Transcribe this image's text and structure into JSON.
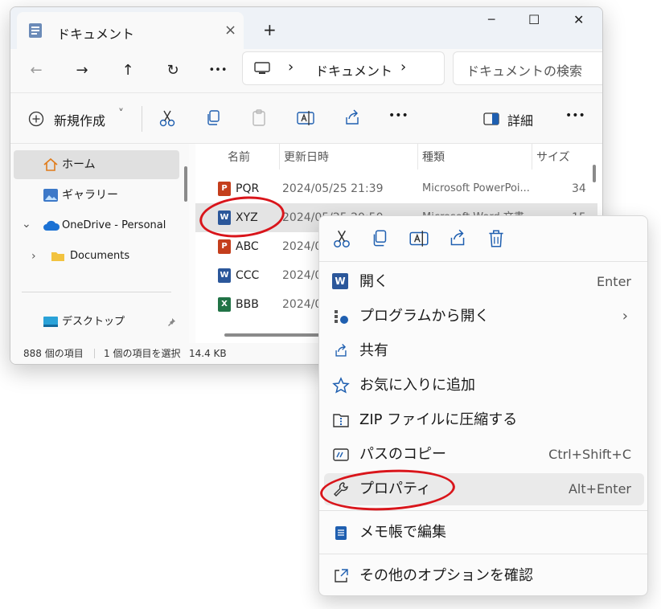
{
  "window": {
    "tab_title": "ドキュメント",
    "tab_close": "×",
    "new_tab": "+",
    "minimize": "─",
    "maximize": "☐",
    "close": "✕"
  },
  "nav": {
    "back": "←",
    "forward": "→",
    "up": "↑",
    "refresh": "↻",
    "more": "•••",
    "address_sep": "›",
    "address_location": "ドキュメント",
    "search_placeholder": "ドキュメントの検索"
  },
  "toolbar": {
    "new_label": "新規作成",
    "new_chevron": "˅",
    "more": "•••",
    "details_label": "詳細",
    "more2": "•••"
  },
  "sidebar": {
    "items": [
      {
        "label": "ホーム",
        "icon": "home-icon"
      },
      {
        "label": "ギャラリー",
        "icon": "gallery-icon"
      },
      {
        "label": "OneDrive - Personal",
        "icon": "cloud-icon",
        "expander": "⌄"
      },
      {
        "label": "Documents",
        "icon": "folder-icon",
        "expander": "›"
      },
      {
        "label": "デスクトップ",
        "icon": "desktop-icon"
      }
    ]
  },
  "columns": {
    "name": "名前",
    "modified": "更新日時",
    "type": "種類",
    "size": "サイズ"
  },
  "files": [
    {
      "name": "PQR",
      "date": "2024/05/25 21:39",
      "type": "Microsoft PowerPoi...",
      "size": "34",
      "kind": "ppt",
      "kind_letter": "P"
    },
    {
      "name": "XYZ",
      "date": "2024/05/25 20:50",
      "type": "Microsoft Word 文書",
      "size": "15",
      "kind": "word",
      "kind_letter": "W"
    },
    {
      "name": "ABC",
      "date": "2024/0",
      "type": "",
      "size": "",
      "kind": "ppt",
      "kind_letter": "P"
    },
    {
      "name": "CCC",
      "date": "2024/0",
      "type": "",
      "size": "",
      "kind": "word",
      "kind_letter": "W"
    },
    {
      "name": "BBB",
      "date": "2024/0",
      "type": "",
      "size": "",
      "kind": "excel",
      "kind_letter": "X"
    }
  ],
  "status": {
    "count": "888 個の項目",
    "selected": "1 個の項目を選択",
    "size": "14.4 KB"
  },
  "context_menu": {
    "top_icons": [
      "cut-icon",
      "copy-icon",
      "rename-icon",
      "share-icon",
      "delete-icon"
    ],
    "items": [
      {
        "label": "開く",
        "shortcut": "Enter",
        "icon": "word-icon"
      },
      {
        "label": "プログラムから開く",
        "shortcut": "›",
        "icon": "open-with-icon"
      },
      {
        "label": "共有",
        "shortcut": "",
        "icon": "share-icon"
      },
      {
        "label": "お気に入りに追加",
        "shortcut": "",
        "icon": "star-icon"
      },
      {
        "label": "ZIP ファイルに圧縮する",
        "shortcut": "",
        "icon": "zip-icon"
      },
      {
        "label": "パスのコピー",
        "shortcut": "Ctrl+Shift+C",
        "icon": "copy-path-icon"
      },
      {
        "label": "プロパティ",
        "shortcut": "Alt+Enter",
        "icon": "wrench-icon"
      },
      {
        "label": "メモ帳で編集",
        "shortcut": "",
        "icon": "notepad-icon"
      },
      {
        "label": "その他のオプションを確認",
        "shortcut": "",
        "icon": "external-icon"
      }
    ]
  },
  "colors": {
    "accent": "#1f5fb0",
    "annotation": "#d9151b",
    "word": "#2b579a",
    "ppt": "#c43e1c",
    "excel": "#217346"
  }
}
